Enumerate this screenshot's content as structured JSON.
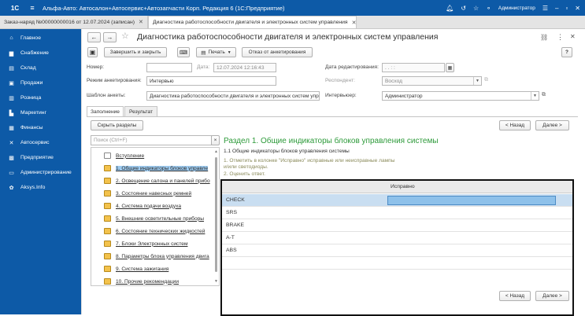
{
  "app": {
    "logo": "1С",
    "title": "Альфа-Авто: Автосалон+Автосервис+Автозапчасти Корп. Редакция 6 (1С:Предприятие)",
    "user": "Администратор"
  },
  "tabs": [
    {
      "label": "Заказ-наряд №00000000016 от 12.07.2024 (записан)",
      "close": "✕"
    },
    {
      "label": "Диагностика работоспособности двигателя и электронных систем управления",
      "close": "✕"
    }
  ],
  "sidebar": {
    "items": [
      {
        "label": "Главное",
        "icon": "home-icon",
        "glyph": "⌂"
      },
      {
        "label": "Снабжение",
        "icon": "truck-icon",
        "glyph": "▆"
      },
      {
        "label": "Склад",
        "icon": "warehouse-icon",
        "glyph": "▤"
      },
      {
        "label": "Продажи",
        "icon": "shopping-cart-icon",
        "glyph": "▣"
      },
      {
        "label": "Розница",
        "icon": "retail-icon",
        "glyph": "▥"
      },
      {
        "label": "Маркетинг",
        "icon": "marketing-icon",
        "glyph": "▙"
      },
      {
        "label": "Финансы",
        "icon": "finance-icon",
        "glyph": "▦"
      },
      {
        "label": "Автосервис",
        "icon": "wrench-icon",
        "glyph": "✕"
      },
      {
        "label": "Предприятие",
        "icon": "enterprise-icon",
        "glyph": "▩"
      },
      {
        "label": "Администрирование",
        "icon": "admin-icon",
        "glyph": "▭"
      },
      {
        "label": "Aksys.Info",
        "icon": "aksys-icon",
        "glyph": "✿"
      }
    ]
  },
  "form": {
    "title": "Диагностика работоспособности двигателя и электронных систем управления",
    "toolbar": {
      "save_close": "Завершить и закрыть",
      "print": "Печать",
      "refuse": "Отказ от анкетирования",
      "help": "?"
    },
    "fields": {
      "number_label": "Номер:",
      "number_value": "",
      "date_label": "Дата:",
      "date_value": "12.07.2024 12:16:43",
      "edit_date_label": "Дата редактирования:",
      "edit_date_value": ".  .     :  :",
      "mode_label": "Режим анкетирования:",
      "mode_value": "Интервью",
      "respondent_label": "Респондент:",
      "respondent_value": "Восход",
      "template_label": "Шаблон анкеты:",
      "template_value": "Диагностика работоспособности двигателя и электронных систем упр",
      "interviewer_label": "Интервьюер:",
      "interviewer_value": "Администратор"
    },
    "inner_tabs": [
      "Заполнение",
      "Результат"
    ],
    "collapse_button": "Скрыть разделы",
    "search_placeholder": "Поиск (Ctrl+F)",
    "search_clear": "×",
    "nav": {
      "back": "< Назад",
      "forward": "Далее >"
    },
    "sections": [
      "Вступление",
      "1. Общие индикаторы блоков управле",
      "2. Освещение салона и панелей прибо",
      "3. Состояние навесных ремней",
      "4. Система подачи воздуха",
      "5. Внешние осветительные приборы",
      "6. Состояние технических жидкостей",
      "7. Блоки Электронных систем",
      "8. Параметры блока управления двига",
      "9. Система зажигания",
      "10. Прочие рекомендации"
    ],
    "section_title": "Раздел 1. Общие индикаторы блоков управления системы",
    "question": "1.1 Общие индикаторы блоков управления системы",
    "hint_1": "1. Отметить в колонке \"Исправно\" исправные или неисправные лампы и/или светодиоды.",
    "hint_2": "2. Оценить ответ.",
    "grid": {
      "column": "Исправно",
      "rows": [
        "CHECK",
        "SRS",
        "BRAKE",
        "A-T",
        "ABS"
      ]
    }
  }
}
